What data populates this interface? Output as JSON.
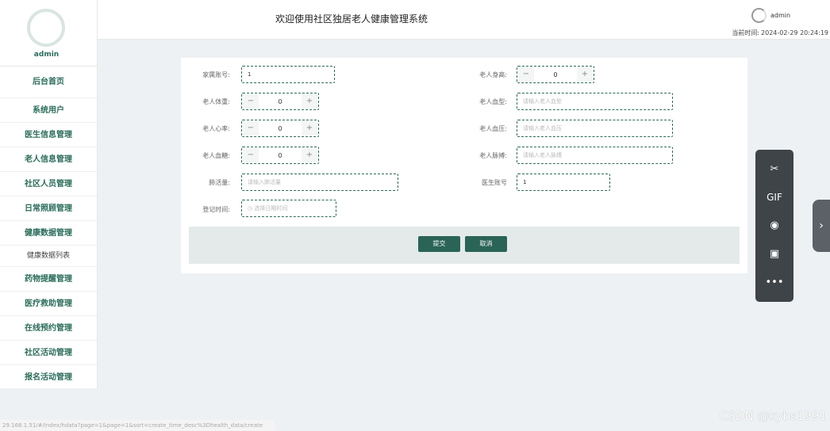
{
  "sidebar": {
    "username": "admin",
    "items": [
      {
        "label": "后台首页"
      },
      {
        "label": "系统用户"
      },
      {
        "label": "医生信息管理"
      },
      {
        "label": "老人信息管理"
      },
      {
        "label": "社区人员管理"
      },
      {
        "label": "日常照顾管理"
      },
      {
        "label": "健康数据管理"
      },
      {
        "label": "健康数据列表"
      },
      {
        "label": "药物提醒管理"
      },
      {
        "label": "医疗救助管理"
      },
      {
        "label": "在线预约管理"
      },
      {
        "label": "社区活动管理"
      },
      {
        "label": "报名活动管理"
      }
    ]
  },
  "header": {
    "title": "欢迎使用社区独居老人健康管理系统",
    "username": "admin",
    "time_label": "当前时间:",
    "time_value": "2024-02-29 20:24:19"
  },
  "form": {
    "family_account": {
      "label": "家属账号:",
      "value": "1"
    },
    "height": {
      "label": "老人身高:",
      "value": "0",
      "minus": "−",
      "plus": "+"
    },
    "weight": {
      "label": "老人体重:",
      "value": "0",
      "minus": "−",
      "plus": "+"
    },
    "blood_type": {
      "label": "老人血型:",
      "placeholder": "请输入老人血型"
    },
    "heart_rate": {
      "label": "老人心率:",
      "value": "0",
      "minus": "−",
      "plus": "+"
    },
    "blood_pressure": {
      "label": "老人血压:",
      "placeholder": "请输入老人血压"
    },
    "blood_sugar": {
      "label": "老人血糖:",
      "value": "0",
      "minus": "−",
      "plus": "+"
    },
    "pulse": {
      "label": "老人脉搏:",
      "placeholder": "请输入老人脉搏"
    },
    "lung_capacity": {
      "label": "肺活量:",
      "placeholder": "请输入肺活量"
    },
    "doctor_account": {
      "label": "医生账号",
      "value": "1"
    },
    "register_time": {
      "label": "登记时间:",
      "placeholder": "选择日期时间"
    },
    "submit_label": "提交",
    "cancel_label": "取消"
  },
  "float_toolbar": {
    "items": [
      "scissors-icon",
      "GIF",
      "record-icon",
      "image-icon",
      "more-icon"
    ],
    "gif_label": "GIF"
  },
  "status_url": "29.168.1.51/#/index/hdata?page=1&page=1&sort=create_time_desc%3Dhealth_data/create",
  "watermark": "CSDN @kybs1991",
  "colors": {
    "accent": "#2a6457",
    "sidebar_text": "#2a6c5a",
    "toolbar_bg": "#3f4448"
  }
}
